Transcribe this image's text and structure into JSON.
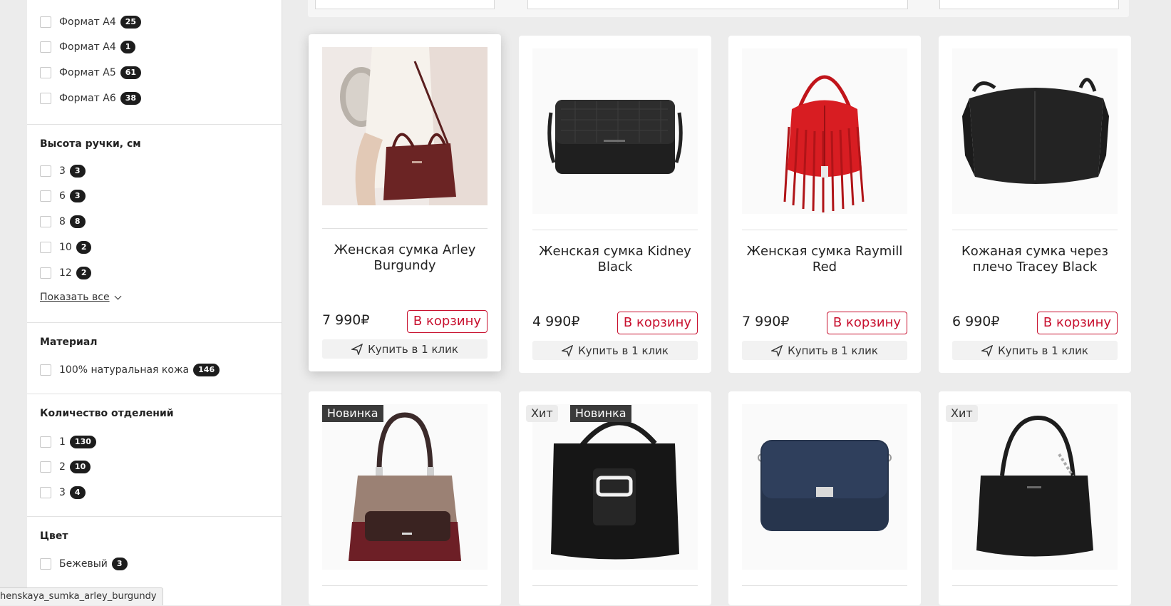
{
  "filters": {
    "format": [
      {
        "label": "Формат А4",
        "count": "25"
      },
      {
        "label": "Формат A4",
        "count": "1"
      },
      {
        "label": "Формат A5",
        "count": "61"
      },
      {
        "label": "Формат A6",
        "count": "38"
      }
    ],
    "handle_height": {
      "title": "Высота ручки, см",
      "items": [
        {
          "label": "3",
          "count": "3"
        },
        {
          "label": "6",
          "count": "3"
        },
        {
          "label": "8",
          "count": "8"
        },
        {
          "label": "10",
          "count": "2"
        },
        {
          "label": "12",
          "count": "2"
        }
      ],
      "show_all": "Показать все"
    },
    "material": {
      "title": "Материал",
      "items": [
        {
          "label": "100% натуральная кожа",
          "count": "146"
        }
      ]
    },
    "compartments": {
      "title": "Количество отделений",
      "items": [
        {
          "label": "1",
          "count": "130"
        },
        {
          "label": "2",
          "count": "10"
        },
        {
          "label": "3",
          "count": "4"
        }
      ]
    },
    "color": {
      "title": "Цвет",
      "items": [
        {
          "label": "Бежевый",
          "count": "3"
        }
      ]
    }
  },
  "products": [
    {
      "title": "Женская сумка Arley Burgundy",
      "price": "7 990₽",
      "cart": "В корзину",
      "oneclick": "Купить в 1 клик",
      "image": "burgundy-bag-model"
    },
    {
      "title": "Женская сумка Kidney Black",
      "price": "4 990₽",
      "cart": "В корзину",
      "oneclick": "Купить в 1 клик",
      "image": "black-croc-crossbody"
    },
    {
      "title": "Женская сумка Raymill Red",
      "price": "7 990₽",
      "cart": "В корзину",
      "oneclick": "Купить в 1 клик",
      "image": "red-fringe-bag"
    },
    {
      "title": "Кожаная сумка через плечо Tracey Black",
      "price": "6 990₽",
      "cart": "В корзину",
      "oneclick": "Купить в 1 клик",
      "image": "black-hobo-bag"
    }
  ],
  "products_row2": [
    {
      "badges": [
        "Новинка"
      ],
      "image": "taupe-burgundy-tote"
    },
    {
      "badges": [
        "Хит",
        "Новинка"
      ],
      "image": "black-bucket-bag"
    },
    {
      "badges": [],
      "image": "navy-flap-bag"
    },
    {
      "badges": [
        "Хит"
      ],
      "image": "black-chain-bag"
    }
  ],
  "status_url": "henskaya_sumka_arley_burgundy",
  "colors": {
    "accent": "#c8102e",
    "badge_dark": "#1d1d1d"
  }
}
